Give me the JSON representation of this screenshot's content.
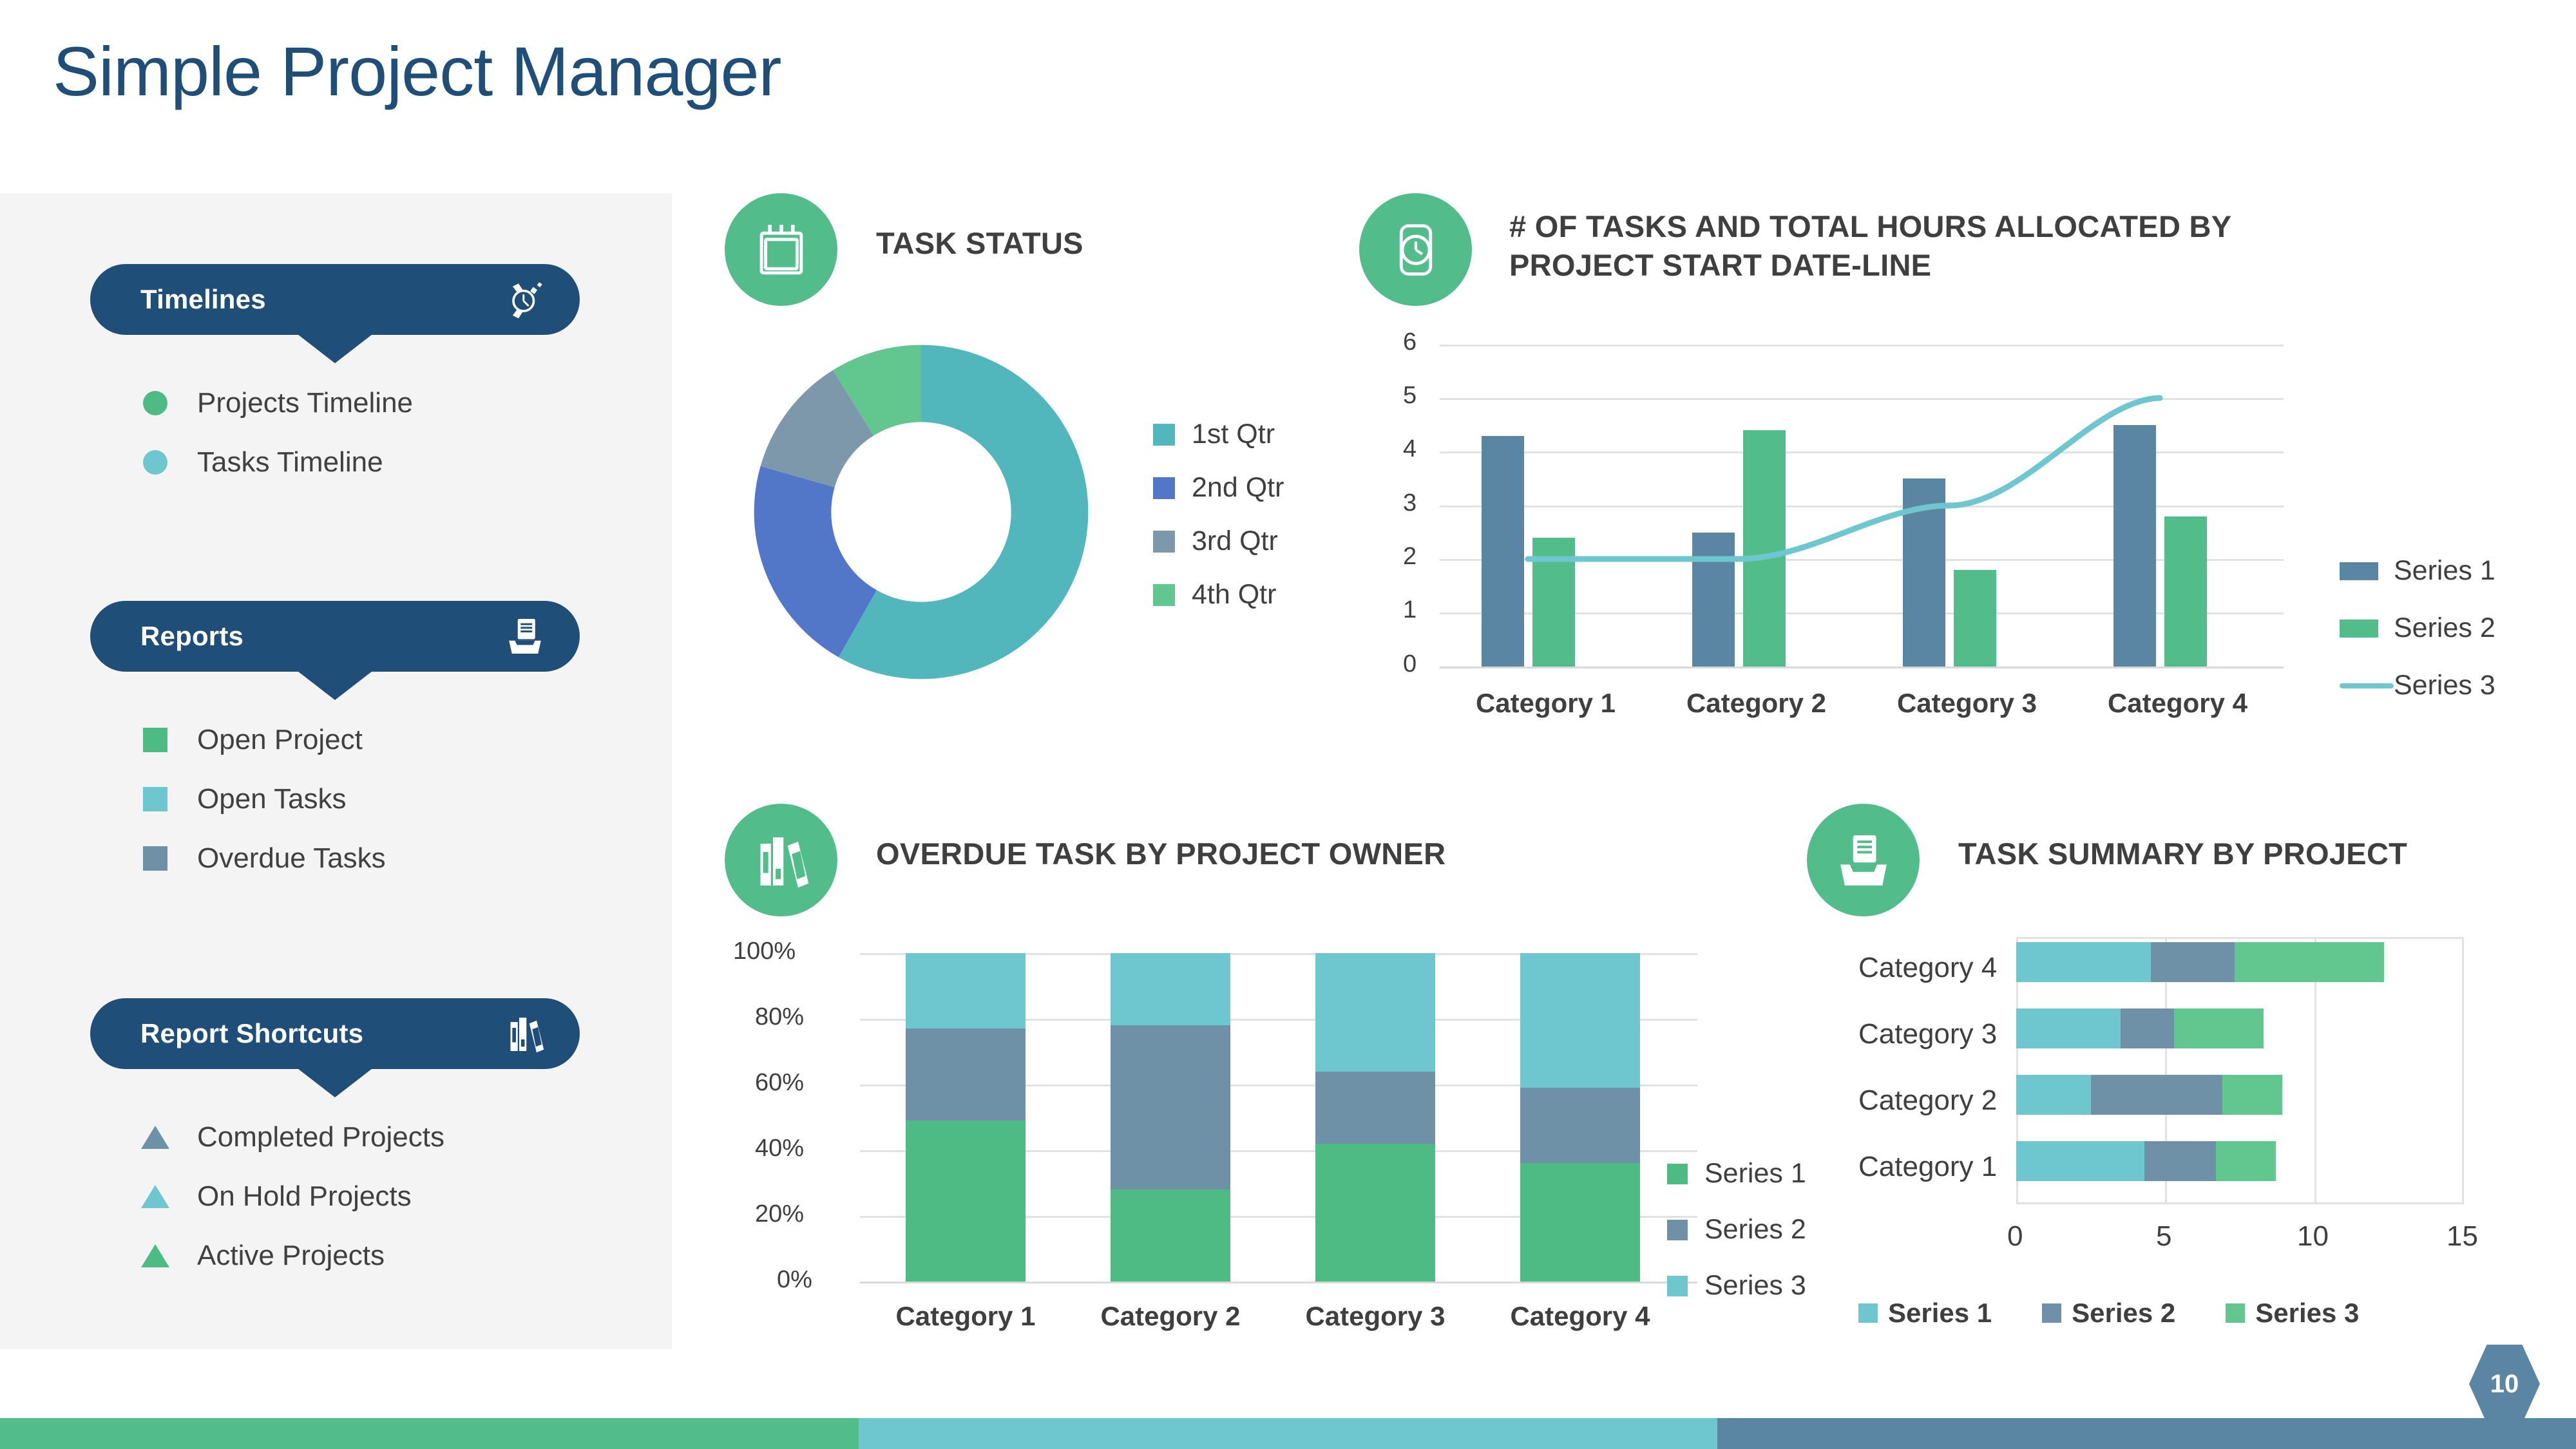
{
  "page": {
    "title": "Simple Project Manager",
    "number": "10"
  },
  "colors": {
    "navy": "#1f4e79",
    "green": "#52bd8a",
    "teal": "#6ec6ce",
    "teal_dark": "#52b6bd",
    "slate": "#5b86a3",
    "blue": "#5277c9",
    "sidebar_bg": "#f4f4f4",
    "text": "#3f3f3f"
  },
  "sidebar": {
    "sections": [
      {
        "header": "Timelines",
        "icon": "wristwatch-icon",
        "items": [
          {
            "label": "Projects Timeline",
            "marker": "dot",
            "color": "#4ebb85"
          },
          {
            "label": "Tasks Timeline",
            "marker": "dot",
            "color": "#6ec6ce"
          }
        ]
      },
      {
        "header": "Reports",
        "icon": "file-tray-icon",
        "items": [
          {
            "label": "Open Project",
            "marker": "square",
            "color": "#4ebb85"
          },
          {
            "label": "Open Tasks",
            "marker": "square",
            "color": "#6ec6ce"
          },
          {
            "label": "Overdue Tasks",
            "marker": "square",
            "color": "#6e91a8"
          }
        ]
      },
      {
        "header": "Report Shortcuts",
        "icon": "books-icon",
        "items": [
          {
            "label": "Completed Projects",
            "marker": "triangle",
            "color": "#6e91a8"
          },
          {
            "label": "On Hold Projects",
            "marker": "triangle",
            "color": "#6ec6ce"
          },
          {
            "label": "Active Projects",
            "marker": "triangle",
            "color": "#4ebb85"
          }
        ]
      }
    ]
  },
  "panels": {
    "task_status": {
      "title": "TASK STATUS",
      "icon": "calendar-icon"
    },
    "tasks_hours": {
      "title": "# OF TASKS AND TOTAL HOURS ALLOCATED BY PROJECT START DATE-LINE",
      "icon": "clock-icon"
    },
    "overdue": {
      "title": "OVERDUE TASK BY PROJECT OWNER",
      "icon": "books-icon"
    },
    "summary": {
      "title": "TASK SUMMARY BY PROJECT",
      "icon": "file-tray-icon"
    }
  },
  "chart_data": [
    {
      "id": "task_status",
      "type": "pie",
      "title": "TASK STATUS",
      "donut": true,
      "legend_position": "right",
      "labels": [
        "1st Qtr",
        "2nd Qtr",
        "3rd Qtr",
        "4th Qtr"
      ],
      "values": [
        58.2,
        21.2,
        11.7,
        8.9
      ],
      "colors": [
        "#52b6bd",
        "#5277c9",
        "#7d97ab",
        "#62c78f"
      ]
    },
    {
      "id": "tasks_hours",
      "type": "bar",
      "title": "# OF TASKS AND TOTAL HOURS ALLOCATED BY PROJECT START DATE-LINE",
      "categories": [
        "Category 1",
        "Category 2",
        "Category 3",
        "Category 4"
      ],
      "series": [
        {
          "name": "Series 1",
          "type": "bar",
          "color": "#5b86a3",
          "values": [
            4.3,
            2.5,
            3.5,
            4.5
          ]
        },
        {
          "name": "Series 2",
          "type": "bar",
          "color": "#52bd8a",
          "values": [
            2.4,
            4.4,
            1.8,
            2.8
          ]
        },
        {
          "name": "Series 3",
          "type": "line",
          "color": "#6ec6ce",
          "values": [
            2,
            2,
            3,
            5
          ]
        }
      ],
      "ylim": [
        0,
        6
      ],
      "yticks": [
        "0",
        "1",
        "2",
        "3",
        "4",
        "5",
        "6"
      ],
      "xlabel": "",
      "ylabel": "",
      "grid": true,
      "legend_position": "right"
    },
    {
      "id": "overdue",
      "type": "bar",
      "stacked": "100%",
      "title": "OVERDUE TASK BY PROJECT OWNER",
      "categories": [
        "Category 1",
        "Category 2",
        "Category 3",
        "Category 4"
      ],
      "series": [
        {
          "name": "Series 1",
          "color": "#4ebb85",
          "values": [
            49,
            28,
            42,
            36
          ]
        },
        {
          "name": "Series 2",
          "color": "#6e91a8",
          "values": [
            28,
            50,
            22,
            23
          ]
        },
        {
          "name": "Series 3",
          "color": "#6ec6ce",
          "values": [
            23,
            22,
            36,
            41
          ]
        }
      ],
      "ylim": [
        0,
        100
      ],
      "yticks": [
        "0%",
        "20%",
        "40%",
        "60%",
        "80%",
        "100%"
      ],
      "grid": true,
      "legend_position": "right"
    },
    {
      "id": "summary",
      "type": "bar",
      "orientation": "horizontal",
      "stacked": true,
      "title": "TASK SUMMARY BY PROJECT",
      "categories": [
        "Category 4",
        "Category 3",
        "Category 2",
        "Category 1"
      ],
      "series": [
        {
          "name": "Series 1",
          "color": "#6ec6ce",
          "values": [
            4.5,
            3.5,
            2.5,
            4.3
          ]
        },
        {
          "name": "Series 2",
          "color": "#6e91a8",
          "values": [
            2.8,
            1.8,
            4.4,
            2.4
          ]
        },
        {
          "name": "Series 3",
          "color": "#62c78f",
          "values": [
            5.0,
            3.0,
            2.0,
            2.0
          ]
        }
      ],
      "xlim": [
        0,
        15
      ],
      "xticks": [
        "0",
        "5",
        "10",
        "15"
      ],
      "grid": true,
      "legend_position": "bottom"
    }
  ],
  "footer": {
    "bands": [
      "#52bd8a",
      "#6ec6ce",
      "#5b86a3"
    ]
  }
}
